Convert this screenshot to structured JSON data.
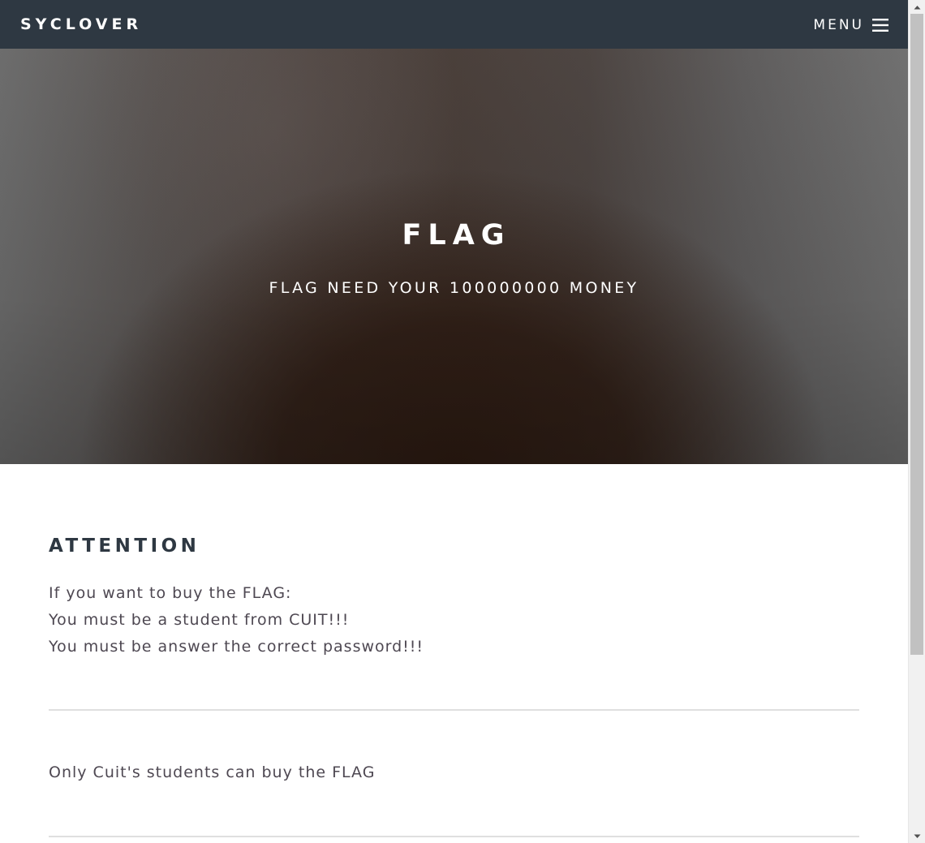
{
  "header": {
    "brand": "SYCLOVER",
    "menu_label": "MENU",
    "menu_icon": "hamburger-menu-icon"
  },
  "hero": {
    "title": "FLAG",
    "subtitle": "FLAG NEED YOUR 100000000 MONEY"
  },
  "main": {
    "heading": "ATTENTION",
    "lines": [
      "If you want to buy the FLAG:",
      "You must be a student from CUIT!!!",
      "You must be answer the correct password!!!"
    ],
    "notice": "Only Cuit's students can buy the FLAG"
  },
  "colors": {
    "header_bg": "#2e3842",
    "heading": "#2e3842",
    "body_text": "#4e4852",
    "divider": "#dfdfdf",
    "banner_dark": "#2d1b12"
  },
  "scrollbar": {
    "up_icon": "scroll-up-arrow-icon",
    "down_icon": "scroll-down-arrow-icon"
  }
}
